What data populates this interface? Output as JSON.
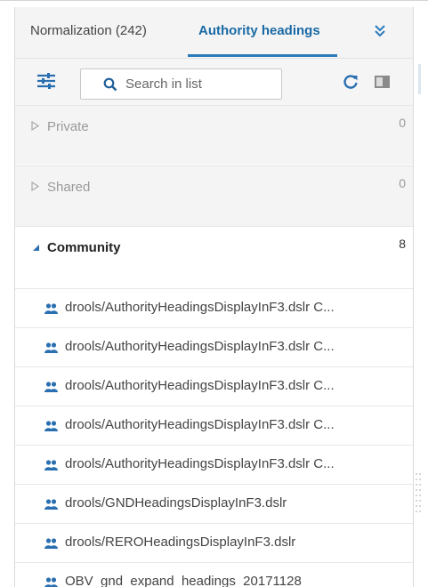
{
  "tabs": {
    "normalization_label": "Normalization (242)",
    "authority_label": "Authority headings"
  },
  "search": {
    "placeholder": "Search in list"
  },
  "sections": {
    "private": {
      "label": "Private",
      "count": "0"
    },
    "shared": {
      "label": "Shared",
      "count": "0"
    },
    "community": {
      "label": "Community",
      "count": "8"
    }
  },
  "community_items": [
    "drools/AuthorityHeadingsDisplayInF3.dslr C...",
    "drools/AuthorityHeadingsDisplayInF3.dslr C...",
    "drools/AuthorityHeadingsDisplayInF3.dslr C...",
    "drools/AuthorityHeadingsDisplayInF3.dslr C...",
    "drools/AuthorityHeadingsDisplayInF3.dslr C...",
    "drools/GNDHeadingsDisplayInF3.dslr",
    "drools/REROHeadingsDisplayInF3.dslr",
    "OBV_gnd_expand_headings_20171128"
  ],
  "colors": {
    "accent": "#1a6aa6",
    "tab_underline": "#2a7bbd",
    "icon_blue": "#2a6fb0"
  },
  "icons": [
    "sliders-icon",
    "search-icon",
    "refresh-icon",
    "panel-toggle-icon",
    "chevron-double-down-icon",
    "users-icon",
    "caret-right-icon",
    "caret-down-icon"
  ]
}
